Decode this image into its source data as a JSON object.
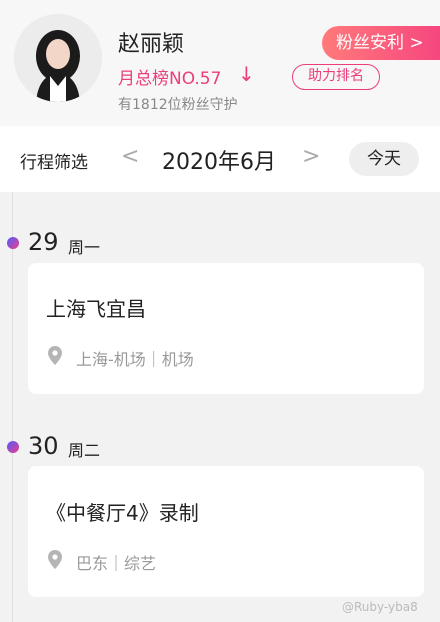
{
  "profile": {
    "name": "赵丽颖",
    "rank": "月总榜NO.57",
    "rank_arrow": "↓",
    "fans_text": "有1812位粉丝守护",
    "anli_button": "粉丝安利 >",
    "zhuli_button": "助力排名"
  },
  "filter": {
    "label": "行程筛选",
    "prev": "<",
    "month": "2020年6月",
    "next": ">",
    "today_button": "今天"
  },
  "schedule": [
    {
      "day": "29",
      "weekday": "周一",
      "title": "上海飞宜昌",
      "location": "上海-机场｜机场"
    },
    {
      "day": "30",
      "weekday": "周二",
      "title": "《中餐厅4》录制",
      "location": "巴东｜综艺"
    }
  ],
  "watermark": "@Ruby-yba8",
  "colors": {
    "accent": "#ec3d7c",
    "gradient_start": "#ff7a7a",
    "gradient_end": "#f5457f"
  },
  "icons": {
    "location": "location-pin-icon",
    "avatar": "avatar-photo"
  }
}
